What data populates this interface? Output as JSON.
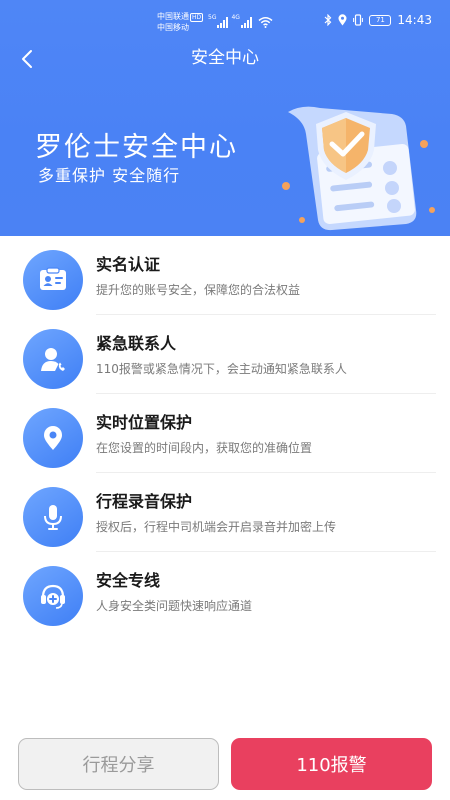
{
  "status_bar": {
    "carrier_1": "中国联通",
    "carrier_1_badge": "HD",
    "carrier_2": "中国移动",
    "signal_1_label": "5G",
    "signal_2_label": "4G",
    "battery": "71",
    "time": "14:43"
  },
  "nav": {
    "title": "安全中心"
  },
  "hero": {
    "title": "罗伦士安全中心",
    "subtitle": "多重保护  安全随行"
  },
  "colors": {
    "header_blue": "#4b82f4",
    "icon_blue": "#4a86f6",
    "alarm_red": "#e9405f"
  },
  "features": [
    {
      "title": "实名认证",
      "desc": "提升您的账号安全，保障您的合法权益",
      "icon": "id-card-icon"
    },
    {
      "title": "紧急联系人",
      "desc": "110报警或紧急情况下，会主动通知紧急联系人",
      "icon": "contact-phone-icon"
    },
    {
      "title": "实时位置保护",
      "desc": "在您设置的时间段内，获取您的准确位置",
      "icon": "location-pin-icon"
    },
    {
      "title": "行程录音保护",
      "desc": "授权后，行程中司机端会开启录音并加密上传",
      "icon": "microphone-icon"
    },
    {
      "title": "安全专线",
      "desc": "人身安全类问题快速响应通道",
      "icon": "headset-icon"
    }
  ],
  "buttons": {
    "share": "行程分享",
    "alarm": "110报警"
  }
}
